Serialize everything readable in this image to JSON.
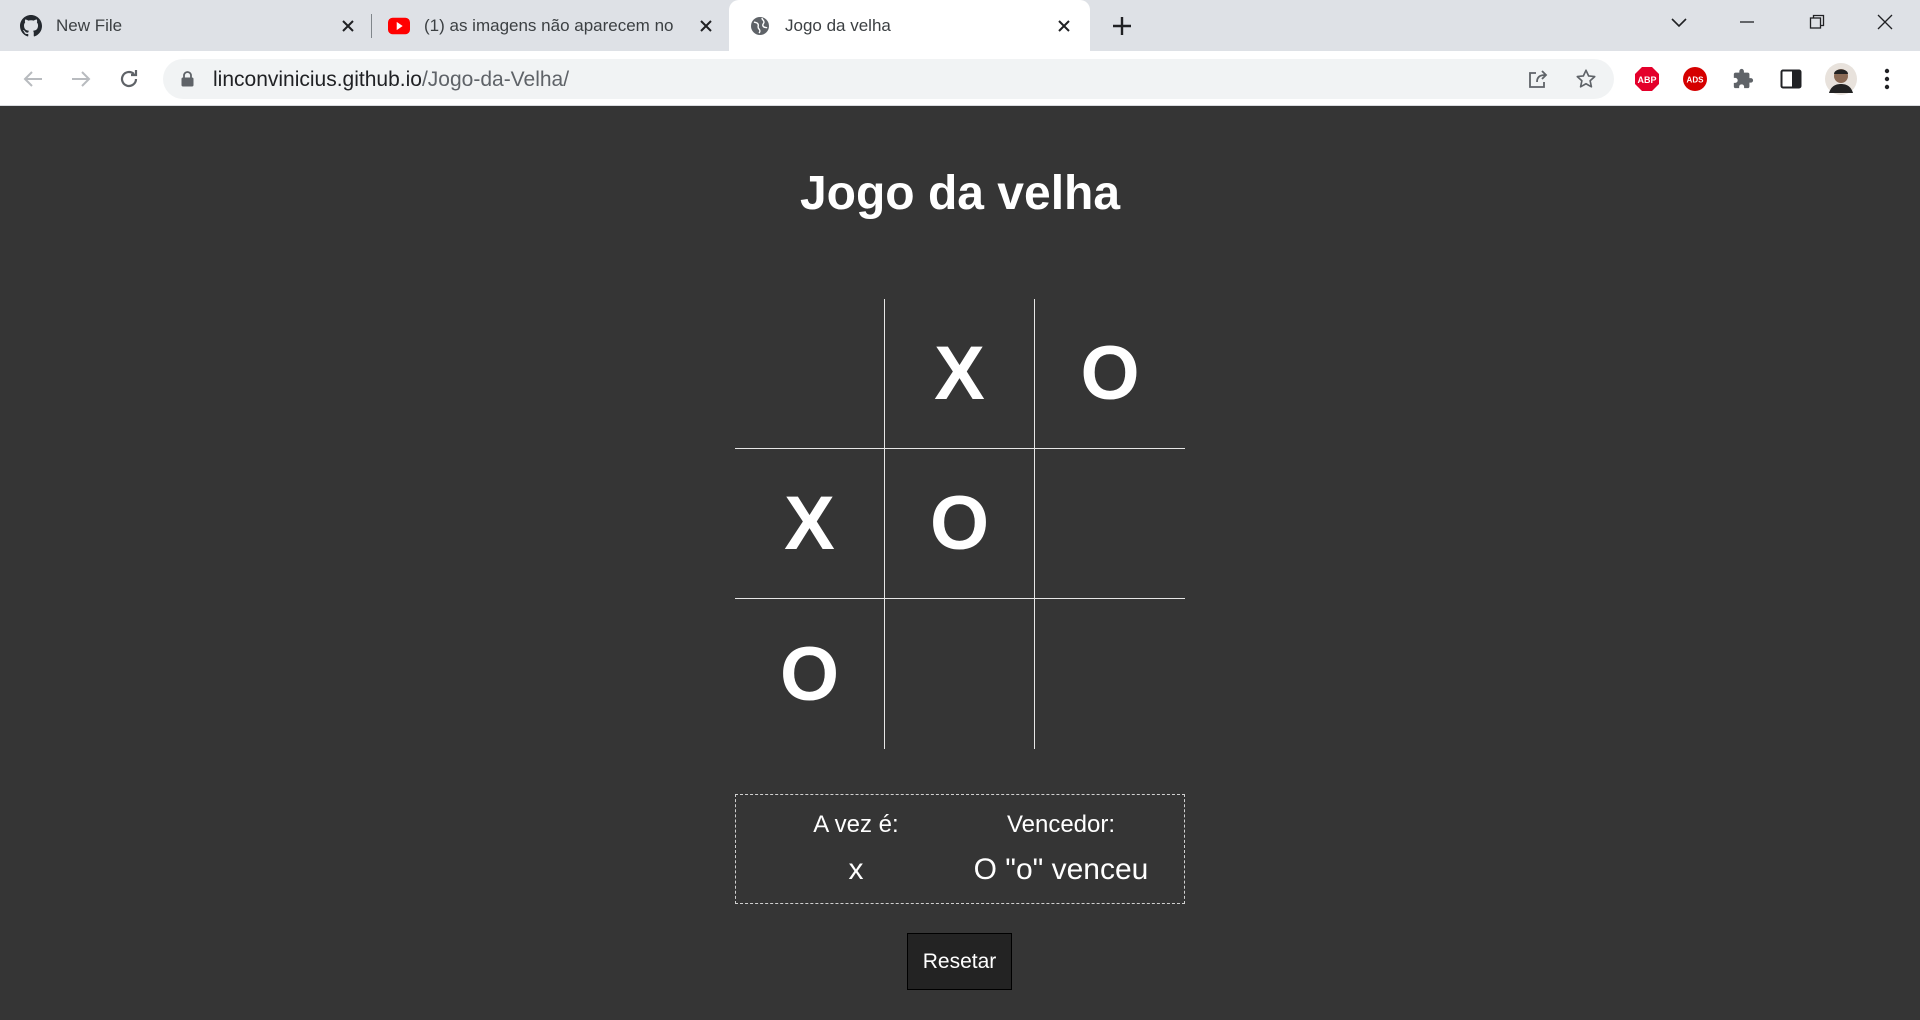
{
  "browser": {
    "tabs": [
      {
        "title": "New File",
        "icon": "github-icon"
      },
      {
        "title": "(1) as imagens não aparecem no",
        "icon": "youtube-icon"
      },
      {
        "title": "Jogo da velha",
        "icon": "globe-icon",
        "active": true
      }
    ],
    "url_domain": "linconvinicius.github.io",
    "url_path": "/Jogo-da-Velha/"
  },
  "page": {
    "title": "Jogo da velha"
  },
  "board": {
    "cells": [
      "",
      "X",
      "O",
      "X",
      "O",
      "",
      "O",
      "",
      ""
    ]
  },
  "status": {
    "turn_label": "A vez é:",
    "turn_value": "x",
    "winner_label": "Vencedor:",
    "winner_value": "O \"o\" venceu"
  },
  "reset_label": "Resetar",
  "colors": {
    "page_background": "#353535",
    "text": "#ffffff",
    "grid_lines": "#e6e6e6",
    "button_background": "#232323"
  }
}
